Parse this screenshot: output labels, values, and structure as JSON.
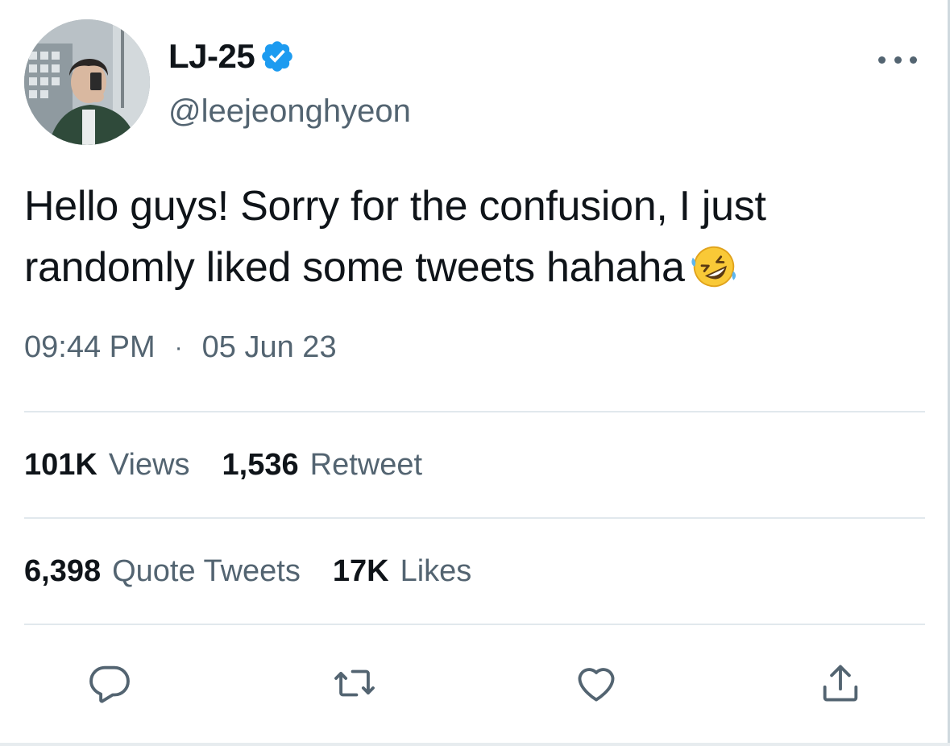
{
  "user": {
    "display_name": "LJ-25",
    "handle": "@leejeonghyeon",
    "verified_icon": "verified-badge-icon",
    "accent": "#1d9bf0"
  },
  "tweet": {
    "text": "Hello guys! Sorry for the confusion, I just randomly liked some tweets hahaha",
    "emoji": "rolling-on-floor-laughing-emoji",
    "time": "09:44 PM",
    "separator": "·",
    "date": "05 Jun 23"
  },
  "stats": {
    "views": {
      "count": "101K",
      "label": "Views"
    },
    "retweets": {
      "count": "1,536",
      "label": "Retweet"
    },
    "quotes": {
      "count": "6,398",
      "label": "Quote Tweets"
    },
    "likes": {
      "count": "17K",
      "label": "Likes"
    }
  },
  "actions": {
    "reply": "reply-icon",
    "retweet": "retweet-icon",
    "like": "heart-icon",
    "share": "share-icon"
  },
  "colors": {
    "text_primary": "#0f1419",
    "text_secondary": "#536471",
    "divider": "#e1e8ed"
  }
}
